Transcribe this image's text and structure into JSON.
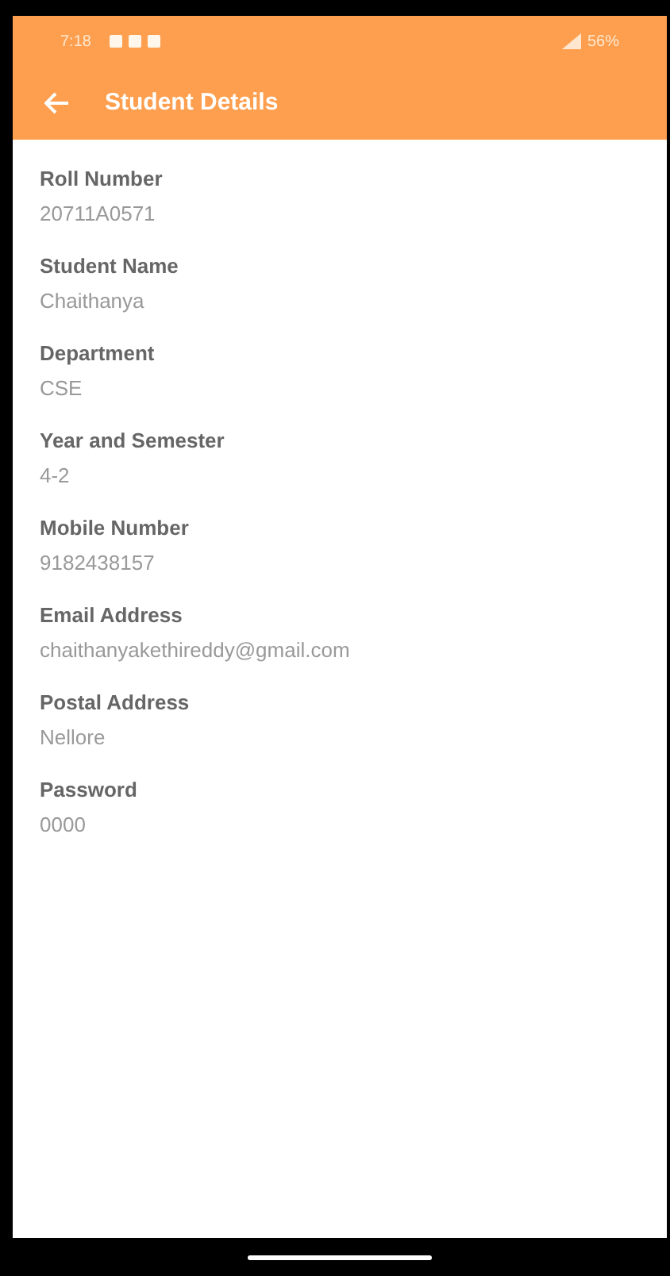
{
  "status_bar": {
    "time": "7:18",
    "battery": "56%"
  },
  "app_bar": {
    "title": "Student Details"
  },
  "fields": [
    {
      "label": "Roll Number",
      "value": "20711A0571"
    },
    {
      "label": "Student Name",
      "value": "Chaithanya"
    },
    {
      "label": "Department",
      "value": "CSE"
    },
    {
      "label": "Year and Semester",
      "value": "4-2"
    },
    {
      "label": "Mobile Number",
      "value": "9182438157"
    },
    {
      "label": "Email Address",
      "value": "chaithanyakethireddy@gmail.com"
    },
    {
      "label": "Postal Address",
      "value": "Nellore"
    },
    {
      "label": "Password",
      "value": "0000"
    }
  ]
}
